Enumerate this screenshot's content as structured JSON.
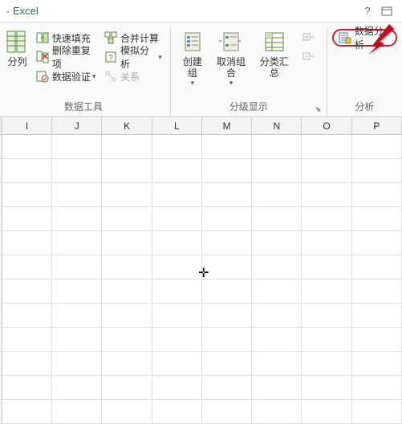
{
  "app": {
    "dash": "-",
    "title": "Excel"
  },
  "ribbon": {
    "col_split": "分列",
    "flash_fill": "快速填充",
    "remove_dup": "删除重复项",
    "data_valid": "数据验证",
    "consolidate": "合并计算",
    "whatif": "模拟分析",
    "relations": "关系",
    "group_datatools": "数据工具",
    "create_group": "创建组",
    "ungroup": "取消组合",
    "subtotal": "分类汇总",
    "group_outline": "分级显示",
    "data_analysis": "数据分析",
    "group_analysis": "分析"
  },
  "columns": [
    "I",
    "J",
    "K",
    "L",
    "M",
    "N",
    "O",
    "P"
  ]
}
